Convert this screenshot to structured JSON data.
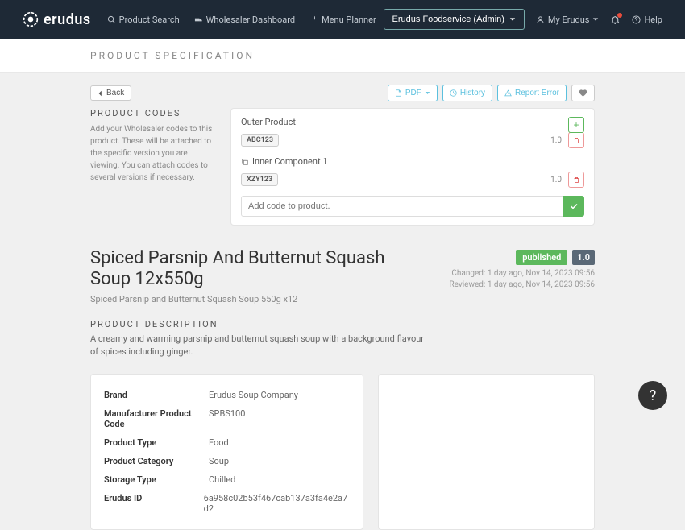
{
  "nav": {
    "brand": "erudus",
    "links": [
      "Product Search",
      "Wholesaler Dashboard",
      "Menu Planner"
    ],
    "admin_label": "Erudus Foodservice (Admin)",
    "my_erudus": "My Erudus",
    "help": "Help"
  },
  "spec_title": "PRODUCT SPECIFICATION",
  "back_label": "Back",
  "actions": {
    "pdf": "PDF",
    "history": "History",
    "report": "Report Error"
  },
  "codes": {
    "heading": "PRODUCT CODES",
    "description": "Add your Wholesaler codes to this product. These will be attached to the specific version you are viewing. You can attach codes to several versions if necessary.",
    "outer_label": "Outer Product",
    "outer_code": "ABC123",
    "outer_version": "1.0",
    "inner_label": "Inner Component 1",
    "inner_code": "XZY123",
    "inner_version": "1.0",
    "add_placeholder": "Add code to product."
  },
  "product": {
    "title": "Spiced Parsnip And Butternut Squash Soup 12x550g",
    "subtitle": "Spiced Parsnip and Butternut Squash Soup 550g x12",
    "status": "published",
    "version": "1.0",
    "changed": "Changed: 1 day ago, Nov 14, 2023 09:56",
    "reviewed": "Reviewed: 1 day ago, Nov 14, 2023 09:56",
    "desc_heading": "PRODUCT DESCRIPTION",
    "description": "A creamy and warming parsnip and butternut squash soup with a background flavour of spices including ginger."
  },
  "info": [
    {
      "label": "Brand",
      "value": "Erudus Soup Company"
    },
    {
      "label": "Manufacturer Product Code",
      "value": "SPBS100"
    },
    {
      "label": "Product Type",
      "value": "Food"
    },
    {
      "label": "Product Category",
      "value": "Soup"
    },
    {
      "label": "Storage Type",
      "value": "Chilled"
    },
    {
      "label": "Erudus ID",
      "value": "6a958c02b53f467cab137a3fa4e2a7d2"
    }
  ]
}
